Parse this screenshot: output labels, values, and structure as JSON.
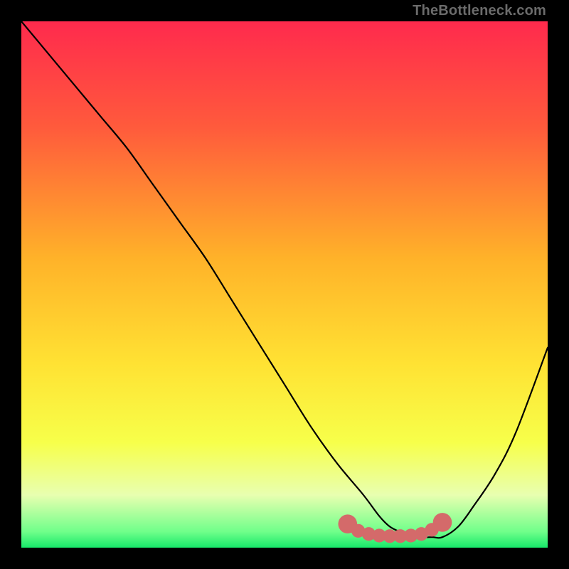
{
  "watermark": "TheBottleneck.com",
  "chart_data": {
    "type": "line",
    "title": "",
    "xlabel": "",
    "ylabel": "",
    "xlim": [
      0,
      100
    ],
    "ylim": [
      0,
      100
    ],
    "background_gradient": {
      "stops": [
        {
          "offset": 0,
          "color": "#ff2a4d"
        },
        {
          "offset": 20,
          "color": "#ff5a3c"
        },
        {
          "offset": 45,
          "color": "#ffb229"
        },
        {
          "offset": 65,
          "color": "#ffe233"
        },
        {
          "offset": 80,
          "color": "#f7ff4a"
        },
        {
          "offset": 90,
          "color": "#e8ffb0"
        },
        {
          "offset": 97,
          "color": "#6fff8a"
        },
        {
          "offset": 100,
          "color": "#17e86a"
        }
      ]
    },
    "series": [
      {
        "name": "bottleneck-curve",
        "color": "#000000",
        "x": [
          0,
          5,
          10,
          15,
          20,
          25,
          30,
          35,
          40,
          45,
          50,
          55,
          60,
          65,
          68,
          70,
          72,
          75,
          78,
          80,
          83,
          86,
          90,
          94,
          100
        ],
        "values": [
          100,
          94,
          88,
          82,
          76,
          69,
          62,
          55,
          47,
          39,
          31,
          23,
          16,
          10,
          6,
          4,
          3,
          2,
          2,
          2,
          4,
          8,
          14,
          22,
          38
        ]
      }
    ],
    "markers": {
      "name": "highlight-band",
      "color": "#d46a6a",
      "points": [
        {
          "x": 62,
          "y": 4.5,
          "r": 1.8
        },
        {
          "x": 64,
          "y": 3.2,
          "r": 1.3
        },
        {
          "x": 66,
          "y": 2.6,
          "r": 1.3
        },
        {
          "x": 68,
          "y": 2.3,
          "r": 1.3
        },
        {
          "x": 70,
          "y": 2.2,
          "r": 1.3
        },
        {
          "x": 72,
          "y": 2.2,
          "r": 1.3
        },
        {
          "x": 74,
          "y": 2.3,
          "r": 1.3
        },
        {
          "x": 76,
          "y": 2.6,
          "r": 1.3
        },
        {
          "x": 78,
          "y": 3.4,
          "r": 1.3
        },
        {
          "x": 80,
          "y": 4.8,
          "r": 1.8
        }
      ]
    }
  }
}
